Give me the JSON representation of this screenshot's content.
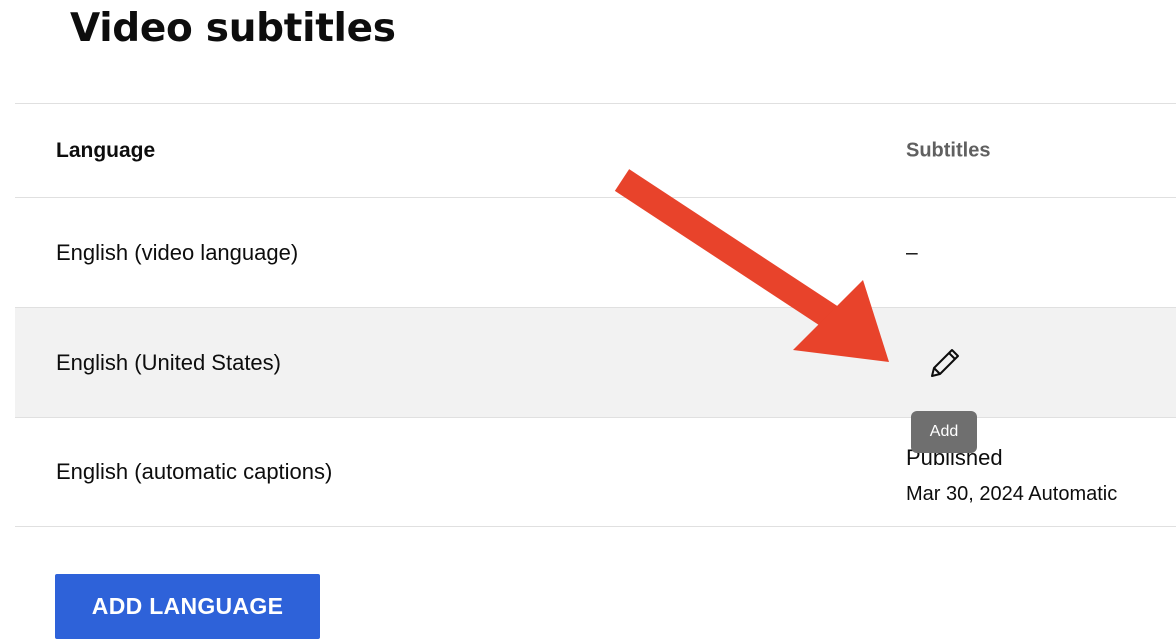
{
  "title": "Video subtitles",
  "table": {
    "headers": {
      "language": "Language",
      "subtitles": "Subtitles"
    },
    "rows": [
      {
        "language": "English (video language)",
        "subtitles": "–"
      },
      {
        "language": "English (United States)",
        "subtitles_icon": "pencil-edit-icon"
      },
      {
        "language": "English (automatic captions)",
        "status": "Published",
        "status_detail": "Mar 30, 2024 Automatic"
      }
    ]
  },
  "tooltip": {
    "text": "Add"
  },
  "add_language_label": "ADD LANGUAGE",
  "colors": {
    "accent_button": "#2e62d9",
    "annotation_arrow": "#e8432b",
    "tooltip_bg": "#6f6f6f",
    "row_hover": "#f2f2f2"
  }
}
